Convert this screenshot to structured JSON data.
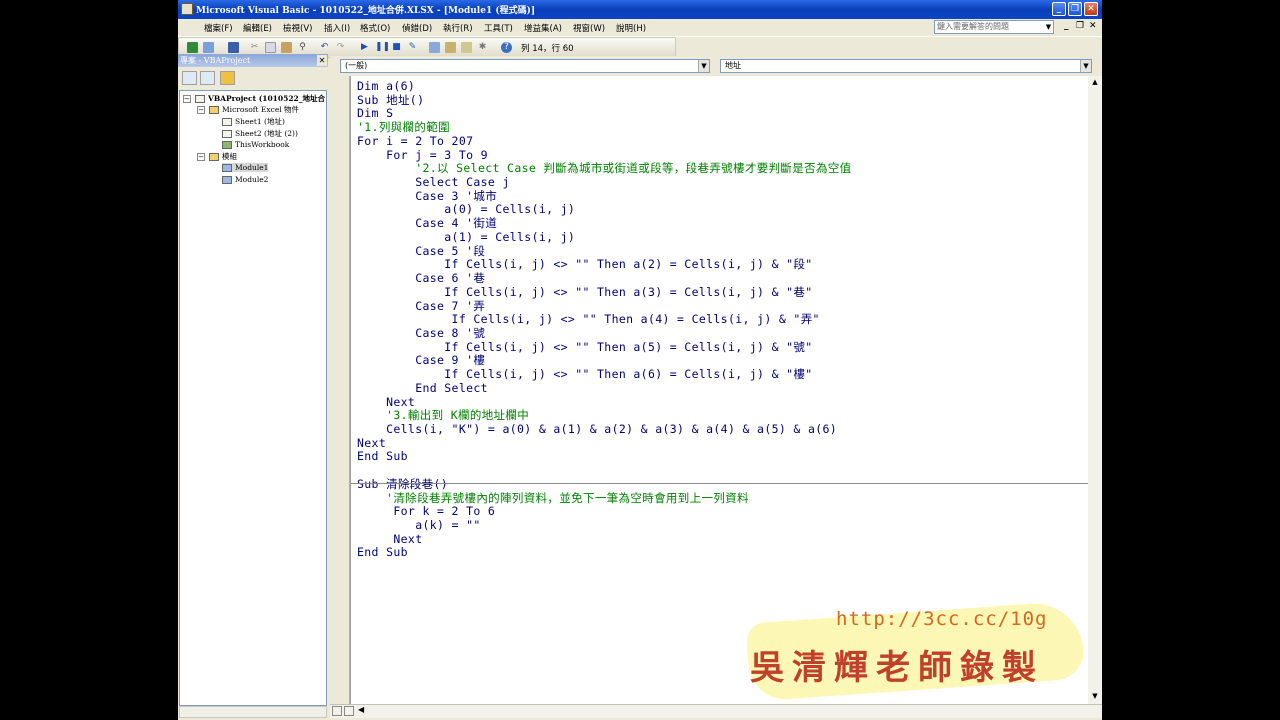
{
  "window": {
    "title": "Microsoft Visual Basic - 1010522_地址合併.XLSX - [Module1 (程式碼)]",
    "minimize": "_",
    "restore": "❐",
    "close": "✕"
  },
  "menu": {
    "items": [
      "檔案(F)",
      "編輯(E)",
      "檢視(V)",
      "插入(I)",
      "格式(O)",
      "偵錯(D)",
      "執行(R)",
      "工具(T)",
      "增益集(A)",
      "視窗(W)",
      "說明(H)"
    ],
    "ask_placeholder": "鍵入需要解答的問題",
    "mdi_min": "_",
    "mdi_restore": "❐",
    "mdi_close": "✕"
  },
  "toolbar": {
    "position_text": "列 14，行 60"
  },
  "project": {
    "title": "專案 - VBAProject",
    "close": "✕",
    "root": "VBAProject (1010522_地址合",
    "folder_excel": "Microsoft Excel 物件",
    "sheet1": "Sheet1 (地址)",
    "sheet2": "Sheet2 (地址 (2))",
    "workbook": "ThisWorkbook",
    "folder_modules": "模組",
    "module1": "Module1",
    "module2": "Module2"
  },
  "code_window": {
    "object_combo": "(一般)",
    "proc_combo": "地址"
  },
  "code_lines": [
    {
      "text": "Dim a(6)",
      "kind": "code"
    },
    {
      "text": "Sub 地址()",
      "kind": "code"
    },
    {
      "text": "Dim S",
      "kind": "code"
    },
    {
      "text": "'1.列與欄的範圍",
      "kind": "comment"
    },
    {
      "text": "For i = 2 To 207",
      "kind": "code"
    },
    {
      "text": "    For j = 3 To 9",
      "kind": "code"
    },
    {
      "text": "        '2.以 Select Case 判斷為城市或街道或段等，段巷弄號樓才要判斷是否為空值",
      "kind": "comment"
    },
    {
      "text": "        Select Case j",
      "kind": "code"
    },
    {
      "text": "        Case 3 '城市",
      "kind": "code"
    },
    {
      "text": "            a(0) = Cells(i, j)",
      "kind": "code"
    },
    {
      "text": "        Case 4 '街道",
      "kind": "code"
    },
    {
      "text": "            a(1) = Cells(i, j)",
      "kind": "code"
    },
    {
      "text": "        Case 5 '段",
      "kind": "code"
    },
    {
      "text": "            If Cells(i, j) <> \"\" Then a(2) = Cells(i, j) & \"段\"",
      "kind": "code"
    },
    {
      "text": "        Case 6 '巷",
      "kind": "code"
    },
    {
      "text": "            If Cells(i, j) <> \"\" Then a(3) = Cells(i, j) & \"巷\"",
      "kind": "code"
    },
    {
      "text": "        Case 7 '弄",
      "kind": "code"
    },
    {
      "text": "             If Cells(i, j) <> \"\" Then a(4) = Cells(i, j) & \"弄\"",
      "kind": "code"
    },
    {
      "text": "        Case 8 '號",
      "kind": "code"
    },
    {
      "text": "            If Cells(i, j) <> \"\" Then a(5) = Cells(i, j) & \"號\"",
      "kind": "code"
    },
    {
      "text": "        Case 9 '樓",
      "kind": "code"
    },
    {
      "text": "            If Cells(i, j) <> \"\" Then a(6) = Cells(i, j) & \"樓\"",
      "kind": "code"
    },
    {
      "text": "        End Select",
      "kind": "code"
    },
    {
      "text": "    Next",
      "kind": "code"
    },
    {
      "text": "    '3.輸出到 K欄的地址欄中",
      "kind": "comment"
    },
    {
      "text": "    Cells(i, \"K\") = a(0) & a(1) & a(2) & a(3) & a(4) & a(5) & a(6)",
      "kind": "code"
    },
    {
      "text": "Next",
      "kind": "code"
    },
    {
      "text": "End Sub",
      "kind": "code"
    },
    {
      "text": "",
      "kind": "code"
    },
    {
      "text": "Sub 清除段巷()",
      "kind": "code"
    },
    {
      "text": "    '清除段巷弄號樓內的陣列資料，並免下一筆為空時會用到上一列資料",
      "kind": "comment"
    },
    {
      "text": "     For k = 2 To 6",
      "kind": "code"
    },
    {
      "text": "        a(k) = \"\"",
      "kind": "code"
    },
    {
      "text": "     Next",
      "kind": "code"
    },
    {
      "text": "End Sub",
      "kind": "code"
    }
  ],
  "watermark": {
    "url": "http://3cc.cc/10g",
    "name": "吳清輝老師錄製"
  }
}
